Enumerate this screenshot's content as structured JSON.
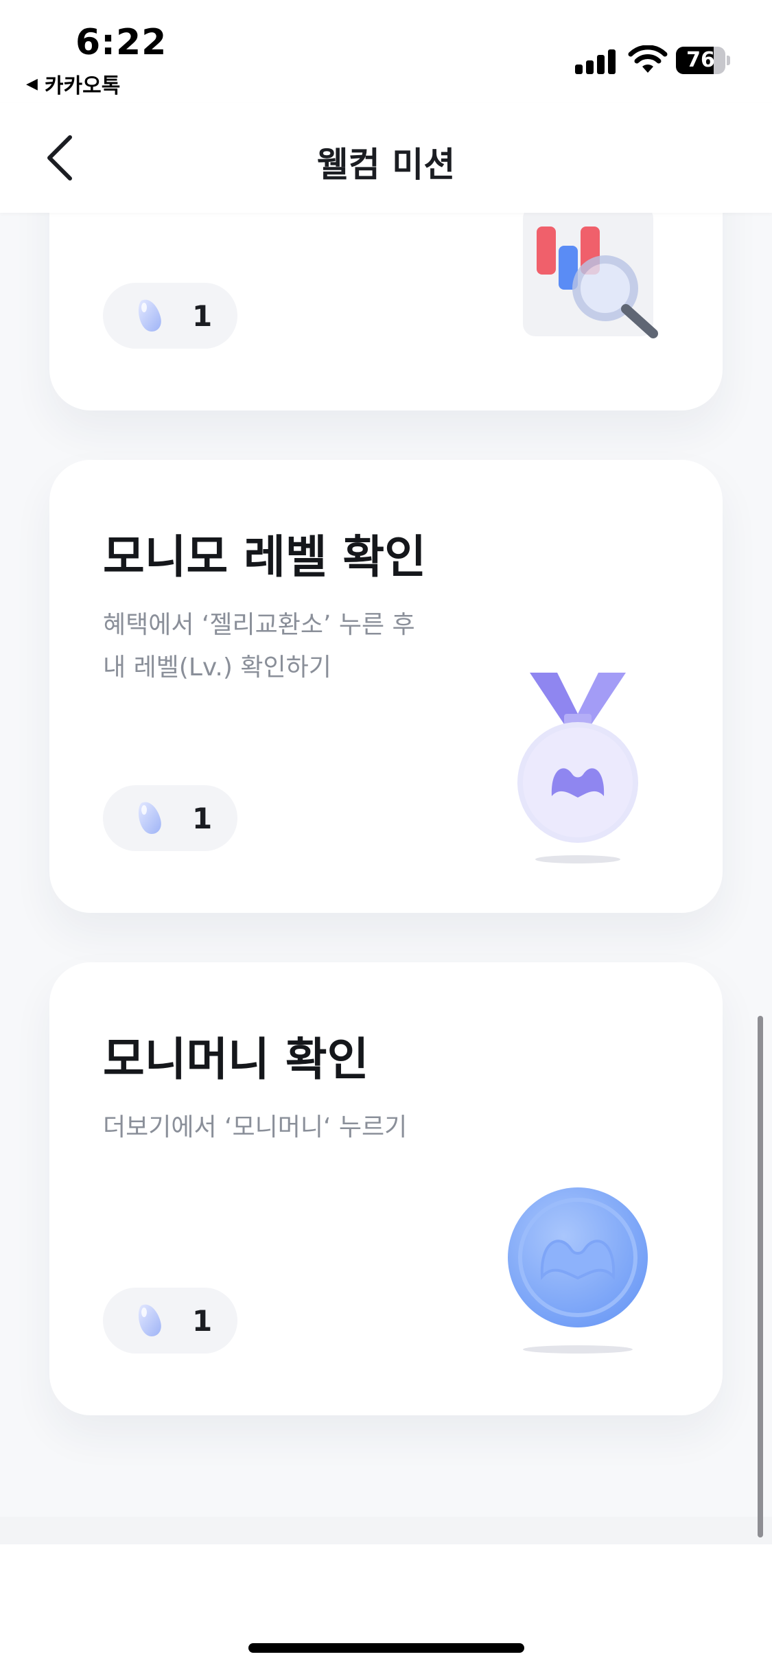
{
  "status_bar": {
    "time": "6:22",
    "back_app": "카카오톡",
    "back_arrow_glyph": "◀",
    "battery_percent": "76",
    "battery_level": 0.76,
    "icons": [
      "signal-icon",
      "wifi-icon",
      "battery-icon"
    ]
  },
  "nav": {
    "title": "웰컴 미션",
    "back_icon": "chevron-left-icon"
  },
  "missions": [
    {
      "title": "",
      "description": "",
      "reward_count": "1",
      "reward_icon": "jelly-icon",
      "illustration": "chart-magnifier-icon"
    },
    {
      "title": "모니모 레벨 확인",
      "description": "혜택에서 ‘젤리교환소’ 누른 후\n내 레벨(Lv.) 확인하기",
      "reward_count": "1",
      "reward_icon": "jelly-icon",
      "illustration": "medal-icon"
    },
    {
      "title": "모니머니 확인",
      "description": "더보기에서 ‘모니머니‘ 누르기",
      "reward_count": "1",
      "reward_icon": "jelly-icon",
      "illustration": "coin-icon"
    }
  ],
  "colors": {
    "background": "#f7f8fa",
    "card": "#ffffff",
    "text_primary": "#15171b",
    "text_secondary": "#8a8f99",
    "reward_pill": "#f3f4f7",
    "accent_purple": "#8f86f0",
    "accent_blue": "#7fa9f8"
  }
}
